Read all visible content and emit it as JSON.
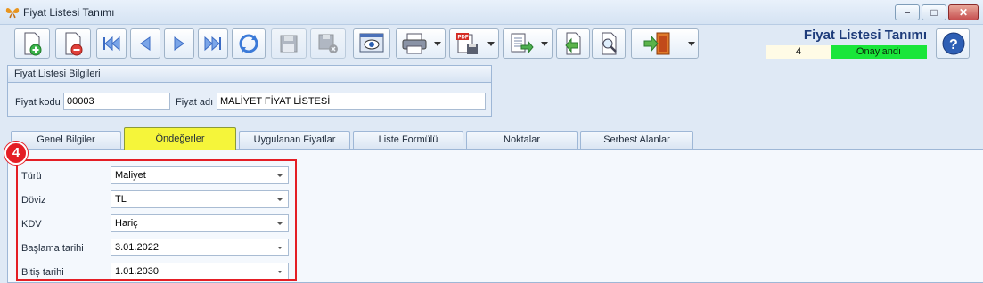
{
  "window": {
    "title": "Fiyat Listesi Tanımı"
  },
  "status": {
    "title": "Fiyat Listesi Tanımı",
    "number": "4",
    "state": "Onaylandı",
    "state_color": "#19e63a"
  },
  "group": {
    "header": "Fiyat Listesi Bilgileri",
    "code_label": "Fiyat kodu",
    "code_value": "00003",
    "name_label": "Fiyat adı",
    "name_value": "MALİYET FİYAT LİSTESİ"
  },
  "tabs": [
    "Genel Bilgiler",
    "Öndeğerler",
    "Uygulanan Fiyatlar",
    "Liste Formülü",
    "Noktalar",
    "Serbest Alanlar"
  ],
  "active_tab": "Öndeğerler",
  "marker": "4",
  "fields": [
    {
      "label": "Türü",
      "value": "Maliyet"
    },
    {
      "label": "Döviz",
      "value": "TL"
    },
    {
      "label": "KDV",
      "value": "Hariç"
    },
    {
      "label": "Başlama tarihi",
      "value": "3.01.2022"
    },
    {
      "label": "Bitiş tarihi",
      "value": "1.01.2030"
    }
  ],
  "toolbar": {
    "icons": [
      "new-document-icon",
      "delete-document-icon",
      "first-record-icon",
      "previous-record-icon",
      "next-record-icon",
      "last-record-icon",
      "refresh-icon",
      "save-icon",
      "save-cancel-icon",
      "preview-icon",
      "print-icon",
      "export-pdf-icon",
      "export-list-icon",
      "import-icon",
      "find-icon",
      "exit-icon",
      "help-icon"
    ]
  },
  "colors": {
    "highlight": "#e41e25",
    "active_tab": "#f5f53a"
  }
}
